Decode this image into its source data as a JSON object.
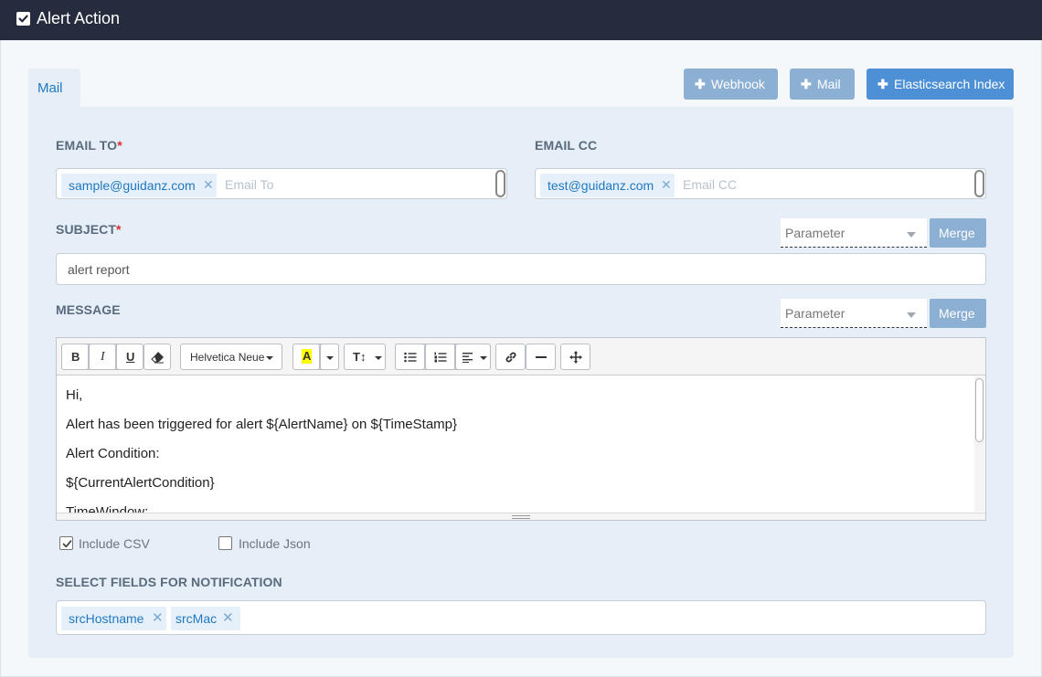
{
  "header": {
    "title": "Alert Action",
    "checked": true
  },
  "tabs": [
    {
      "label": "Mail",
      "active": true
    }
  ],
  "actions": {
    "webhook_label": "Webhook",
    "mail_label": "Mail",
    "es_label": "Elasticsearch Index"
  },
  "email_to": {
    "label": "EMAIL TO",
    "required_mark": "*",
    "chips": [
      "sample@guidanz.com"
    ],
    "placeholder": "Email To"
  },
  "email_cc": {
    "label": "EMAIL CC",
    "chips": [
      "test@guidanz.com"
    ],
    "placeholder": "Email CC"
  },
  "subject": {
    "label": "SUBJECT",
    "required_mark": "*",
    "parameter_placeholder": "Parameter",
    "merge_label": "Merge",
    "value": "alert report"
  },
  "message": {
    "label": "MESSAGE",
    "parameter_placeholder": "Parameter",
    "merge_label": "Merge",
    "toolbar": {
      "bold": "B",
      "italic": "I",
      "underline": "U",
      "font_name": "Helvetica Neue",
      "color_letter": "A",
      "font_size": "T↕"
    },
    "lines": [
      "Hi,",
      "Alert has been triggered for alert ${AlertName} on ${TimeStamp}",
      "Alert Condition:",
      "${CurrentAlertCondition}",
      "TimeWindow:"
    ]
  },
  "options": {
    "include_csv": {
      "label": "Include CSV",
      "checked": true
    },
    "include_json": {
      "label": "Include Json",
      "checked": false
    }
  },
  "fields": {
    "label": "SELECT FIELDS FOR NOTIFICATION",
    "chips": [
      "srcHostname",
      "srcMac"
    ]
  },
  "colors": {
    "header_bg": "#252c3d",
    "accent": "#1f78c1",
    "primary_button": "#4e90d6",
    "muted_button": "#8cb0d4",
    "required": "#d9302a"
  }
}
